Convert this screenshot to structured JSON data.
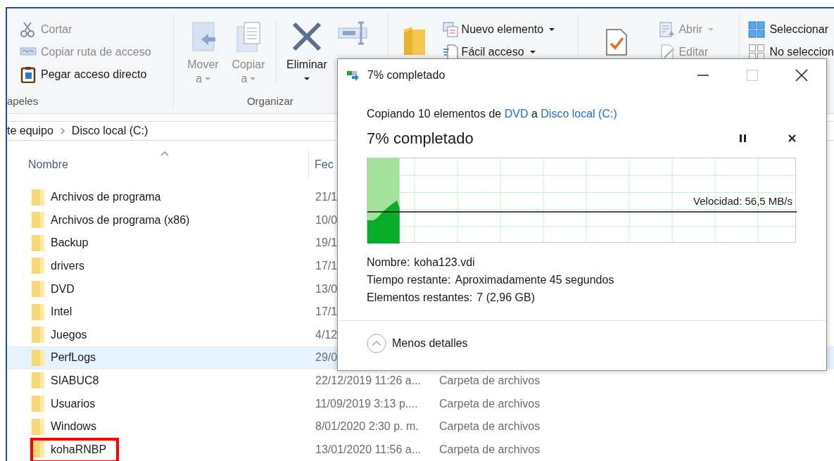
{
  "ribbon": {
    "clipboard": {
      "label": "apeles",
      "items": [
        {
          "label": "Cortar",
          "disabled": true
        },
        {
          "label": "Copiar ruta de acceso",
          "disabled": true
        },
        {
          "label": "Pegar acceso directo",
          "disabled": false
        }
      ]
    },
    "organize": {
      "label": "Organizar",
      "items": [
        {
          "label": "Mover",
          "sublabel": "a",
          "disabled": true
        },
        {
          "label": "Copiar",
          "sublabel": "a",
          "disabled": true
        },
        {
          "label": "Eliminar",
          "disabled": false
        }
      ]
    },
    "new": {
      "items": [
        {
          "label": "Nuevo elemento",
          "dropdown": true
        },
        {
          "label": "Fácil acceso",
          "dropdown": true
        }
      ]
    },
    "open": {
      "items": [
        {
          "label": "Abrir",
          "disabled": true,
          "dropdown": true
        },
        {
          "label": "Editar",
          "disabled": true,
          "dropdown": false
        }
      ]
    },
    "select": {
      "items": [
        {
          "label": "Seleccionar"
        },
        {
          "label": "No seleccion"
        }
      ]
    }
  },
  "address": {
    "crumbs": [
      "te equipo",
      "Disco local (C:)"
    ]
  },
  "columns": [
    {
      "label": "Nombre",
      "sorted": true
    },
    {
      "label": "Fec",
      "sorted": false
    }
  ],
  "rows": [
    {
      "name": "Archivos de programa",
      "date": "21/1",
      "selected": false,
      "highlighted": false
    },
    {
      "name": "Archivos de programa (x86)",
      "date": "10/0",
      "selected": false,
      "highlighted": false
    },
    {
      "name": "Backup",
      "date": "19/1",
      "selected": false,
      "highlighted": false
    },
    {
      "name": "drivers",
      "date": "17/1",
      "selected": false,
      "highlighted": false
    },
    {
      "name": "DVD",
      "date": "13/0",
      "selected": false,
      "highlighted": false
    },
    {
      "name": "Intel",
      "date": "17/1",
      "selected": false,
      "highlighted": false
    },
    {
      "name": "Juegos",
      "date": "4/12",
      "selected": false,
      "highlighted": false
    },
    {
      "name": "PerfLogs",
      "date": "29/0",
      "selected": true,
      "highlighted": false
    },
    {
      "name": "SIABUC8",
      "date": "22/12/2019 11:26 a...",
      "type": "Carpeta de archivos",
      "selected": false,
      "highlighted": false
    },
    {
      "name": "Usuarios",
      "date": "11/09/2019 3:13 p....",
      "type": "Carpeta de archivos",
      "selected": false,
      "highlighted": false
    },
    {
      "name": "Windows",
      "date": "8/01/2020 2:30 p. m.",
      "type": "Carpeta de archivos",
      "selected": false,
      "highlighted": false
    },
    {
      "name": "kohaRNBP",
      "date": "13/01/2020 11:56 a...",
      "type": "Carpeta de archivos",
      "selected": false,
      "highlighted": true
    }
  ],
  "dialog": {
    "title": "7% completado",
    "summary": {
      "prefix": "Copiando 10 elementos de",
      "source": "DVD",
      "middle": "a",
      "destination": "Disco local (C:)"
    },
    "heading": "7% completado",
    "progress": {
      "level": 0.075
    },
    "speed": "Velocidad: 56,5 MB/s",
    "details": [
      {
        "label": "Nombre:",
        "value": "koha123.vdi"
      },
      {
        "label": "Tiempo restante:",
        "value": "Aproximadamente 45 segundos"
      },
      {
        "label": "Elementos restantes:",
        "value": "7 (2,96 GB)"
      }
    ],
    "toggle": "Menos detalles"
  }
}
